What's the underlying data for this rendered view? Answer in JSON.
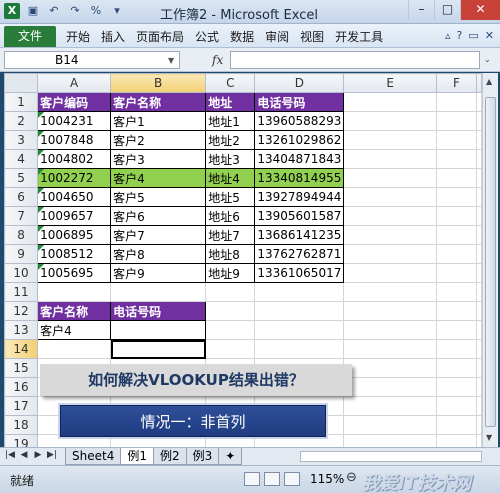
{
  "window": {
    "title": "工作簿2 - Microsoft Excel",
    "qat_icons": [
      "excel-logo-icon",
      "save-icon",
      "undo-icon",
      "redo-icon",
      "percent-format-icon",
      "customize-qat-icon"
    ]
  },
  "ribbon": {
    "file_tab": "文件",
    "tabs": [
      "开始",
      "插入",
      "页面布局",
      "公式",
      "数据",
      "审阅",
      "视图",
      "开发工具"
    ]
  },
  "formula_bar": {
    "name_box": "B14",
    "fx_label": "fx",
    "content": ""
  },
  "columns": [
    "A",
    "B",
    "C",
    "D",
    "E",
    "F"
  ],
  "active_column": "B",
  "active_row": 14,
  "sheet": {
    "header": [
      "客户编码",
      "客户名称",
      "地址",
      "电话号码"
    ],
    "rows": [
      [
        "1004231",
        "客户1",
        "地址1",
        "13960588293"
      ],
      [
        "1007848",
        "客户2",
        "地址2",
        "13261029862"
      ],
      [
        "1004802",
        "客户3",
        "地址3",
        "13404871843"
      ],
      [
        "1002272",
        "客户4",
        "地址4",
        "13340814955"
      ],
      [
        "1004650",
        "客户5",
        "地址5",
        "13927894944"
      ],
      [
        "1009657",
        "客户6",
        "地址6",
        "13905601587"
      ],
      [
        "1006895",
        "客户7",
        "地址7",
        "13686141235"
      ],
      [
        "1008512",
        "客户8",
        "地址8",
        "13762762871"
      ],
      [
        "1005695",
        "客户9",
        "地址9",
        "13361065017"
      ]
    ],
    "highlight_row_index": 3,
    "lookup_header": [
      "客户名称",
      "电话号码"
    ],
    "lookup_value": [
      "客户4",
      ""
    ],
    "highlight_color": "#92d050",
    "header_color": "#7030a0"
  },
  "overlay": {
    "question": "如何解决VLOOKUP结果出错？",
    "case_label": "情况一：非首列"
  },
  "sheet_tabs": [
    "Sheet4",
    "例1",
    "例2",
    "例3"
  ],
  "active_sheet_tab": "例1",
  "status": {
    "ready": "就绪",
    "zoom": "115%"
  },
  "watermark": "我爱IT技术网"
}
